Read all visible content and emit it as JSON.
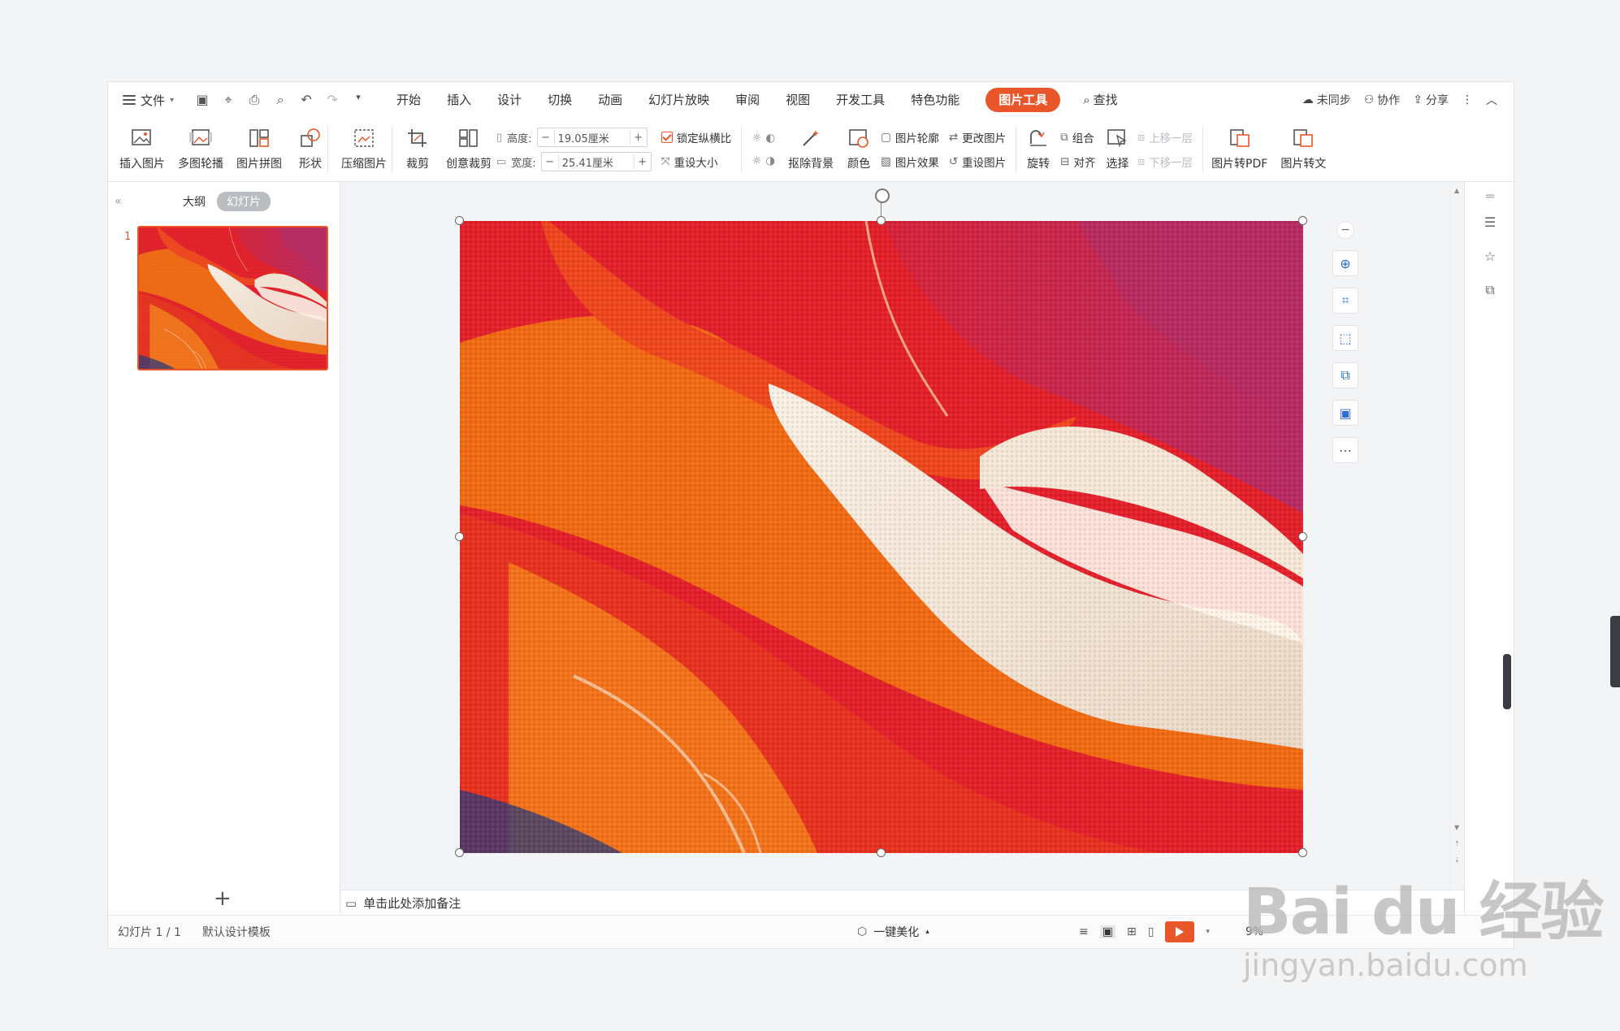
{
  "menubar": {
    "file_label": "文件",
    "tabs": [
      {
        "label": "开始"
      },
      {
        "label": "插入"
      },
      {
        "label": "设计"
      },
      {
        "label": "切换"
      },
      {
        "label": "动画"
      },
      {
        "label": "幻灯片放映"
      },
      {
        "label": "审阅"
      },
      {
        "label": "视图"
      },
      {
        "label": "开发工具"
      },
      {
        "label": "特色功能"
      }
    ],
    "active_tab": "图片工具",
    "search_label": "查找",
    "right": {
      "sync": "未同步",
      "collab": "协作",
      "share": "分享"
    }
  },
  "ribbon": {
    "insert_picture": "插入图片",
    "multi_carousel": "多图轮播",
    "collage": "图片拼图",
    "shape": "形状",
    "compress": "压缩图片",
    "crop": "裁剪",
    "creative_crop": "创意裁剪",
    "height_label": "高度:",
    "height_value": "19.05厘米",
    "width_label": "宽度:",
    "width_value": "25.41厘米",
    "lock_ratio": "锁定纵横比",
    "reset_size": "重设大小",
    "remove_bg": "抠除背景",
    "color": "颜色",
    "outline": "图片轮廓",
    "effects": "图片效果",
    "change_picture": "更改图片",
    "reset_picture": "重设图片",
    "rotate": "旋转",
    "group": "组合",
    "align": "对齐",
    "select": "选择",
    "bring_forward": "上移一层",
    "send_backward": "下移一层",
    "to_pdf": "图片转PDF",
    "to_word": "图片转文"
  },
  "left_panel": {
    "outline_tab": "大纲",
    "slides_tab": "幻灯片",
    "slide_number": "1"
  },
  "notes_placeholder": "单击此处添加备注",
  "status": {
    "slide_info": "幻灯片 1 / 1",
    "template": "默认设计模板",
    "beautify": "一键美化",
    "zoom": "9%"
  },
  "watermark": {
    "brand": "Bai du 经验",
    "url": "jingyan.baidu.com"
  },
  "colors": {
    "accent": "#e8562a",
    "paint_red": "#e4202a",
    "paint_orange": "#f26a12",
    "paint_magenta": "#c8285a",
    "paint_cream": "#f4e6d8"
  }
}
